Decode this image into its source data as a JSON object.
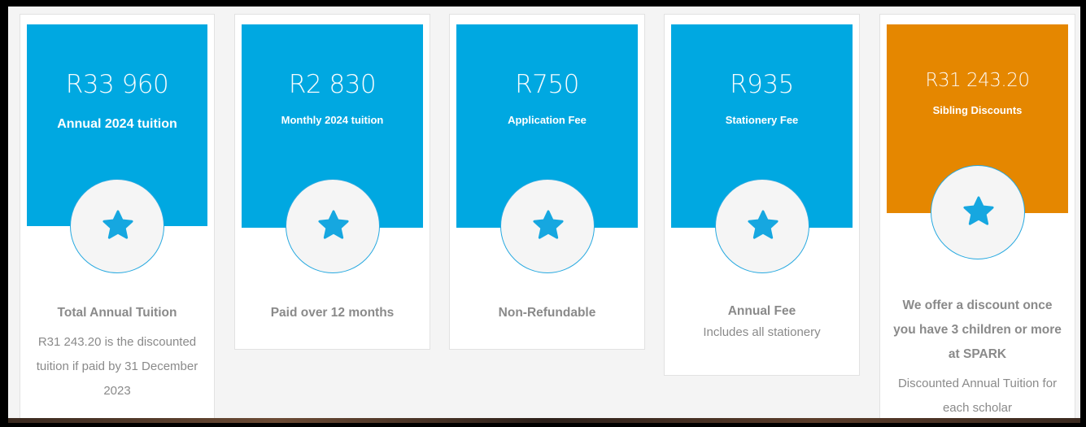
{
  "colors": {
    "blue": "#00a8e1",
    "orange": "#e58700",
    "star": "#16a7e0"
  },
  "cards": [
    {
      "price": "R33 960",
      "label": "Annual 2024 tuition",
      "title": "Total Annual Tuition",
      "text": "R31 243.20 is the discounted tuition if paid by 31 December 2023"
    },
    {
      "price": "R2 830",
      "label": "Monthly 2024 tuition",
      "title": "Paid over 12 months",
      "text": ""
    },
    {
      "price": "R750",
      "label": "Application Fee",
      "title": "Non-Refundable",
      "text": ""
    },
    {
      "price": "R935",
      "label": "Stationery Fee",
      "title": "Annual Fee",
      "text": "Includes all stationery"
    },
    {
      "price": "R31 243.20",
      "label": "Sibling Discounts",
      "title": "We offer a discount once you have 3 children or more at SPARK",
      "text": "Discounted Annual Tuition for each scholar"
    }
  ],
  "icons": {
    "badge": "star-icon"
  }
}
